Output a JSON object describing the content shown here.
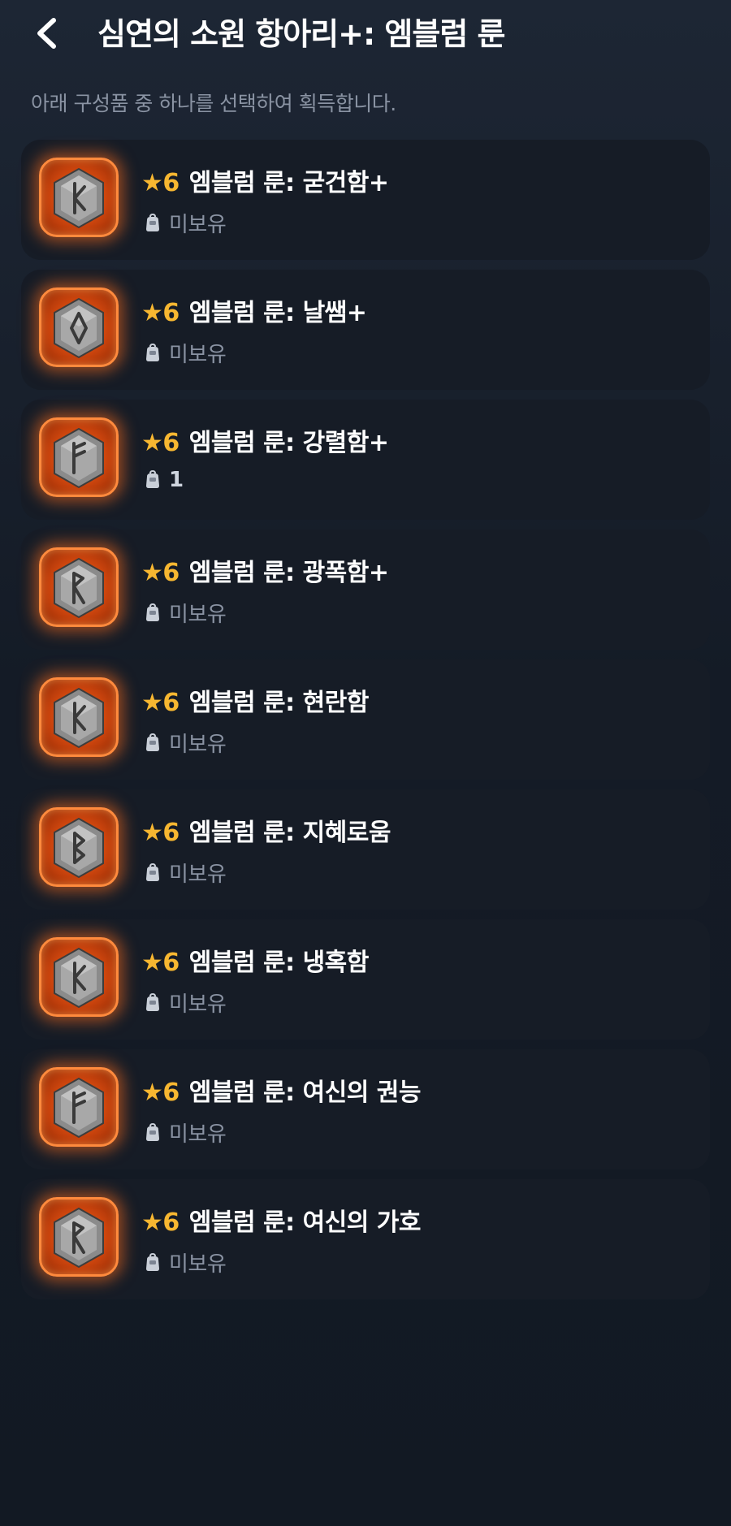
{
  "header": {
    "title": "심연의 소원 항아리+: 엠블럼 룬"
  },
  "subtitle": "아래 구성품 중 하나를 선택하여 획득합니다.",
  "colors": {
    "accent_star": "#f7b731",
    "icon_border": "#ff8a3d",
    "card_background": "#161c26"
  },
  "items": [
    {
      "star": "★",
      "grade": "6",
      "name": "엠블럼 룬: 굳건함+",
      "status": "미보유",
      "owned": false,
      "glyph": "rune-k-icon"
    },
    {
      "star": "★",
      "grade": "6",
      "name": "엠블럼 룬: 날쌤+",
      "status": "미보유",
      "owned": false,
      "glyph": "rune-diamond-icon"
    },
    {
      "star": "★",
      "grade": "6",
      "name": "엠블럼 룬: 강렬함+",
      "status": "1",
      "owned": true,
      "glyph": "rune-f-icon"
    },
    {
      "star": "★",
      "grade": "6",
      "name": "엠블럼 룬: 광폭함+",
      "status": "미보유",
      "owned": false,
      "glyph": "rune-r-icon"
    },
    {
      "star": "★",
      "grade": "6",
      "name": "엠블럼 룬: 현란함",
      "status": "미보유",
      "owned": false,
      "glyph": "rune-k-icon"
    },
    {
      "star": "★",
      "grade": "6",
      "name": "엠블럼 룬: 지혜로움",
      "status": "미보유",
      "owned": false,
      "glyph": "rune-b-icon"
    },
    {
      "star": "★",
      "grade": "6",
      "name": "엠블럼 룬: 냉혹함",
      "status": "미보유",
      "owned": false,
      "glyph": "rune-k-icon"
    },
    {
      "star": "★",
      "grade": "6",
      "name": "엠블럼 룬: 여신의 권능",
      "status": "미보유",
      "owned": false,
      "glyph": "rune-f-icon"
    },
    {
      "star": "★",
      "grade": "6",
      "name": "엠블럼 룬: 여신의 가호",
      "status": "미보유",
      "owned": false,
      "glyph": "rune-r-icon"
    }
  ]
}
